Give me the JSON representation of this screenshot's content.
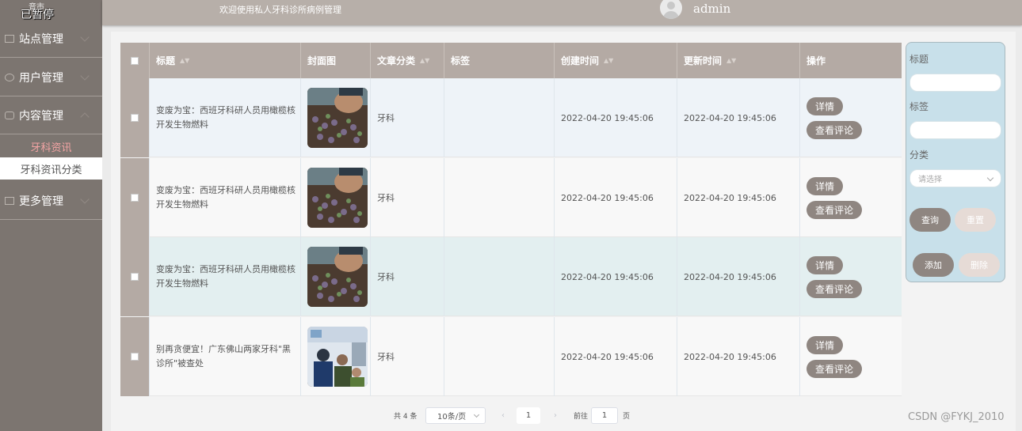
{
  "player": {
    "paused_label": "已暂停",
    "paused_above": "音市"
  },
  "header": {
    "welcome": "欢迎使用私人牙科诊所病例管理",
    "username": "admin"
  },
  "sidebar": {
    "items": [
      {
        "label": "站点管理"
      },
      {
        "label": "用户管理"
      },
      {
        "label": "内容管理"
      },
      {
        "label": "更多管理"
      }
    ],
    "sub_items": [
      {
        "label": "牙科资讯"
      },
      {
        "label": "牙科资讯分类"
      }
    ]
  },
  "table": {
    "columns": [
      "标题",
      "封面图",
      "文章分类",
      "标签",
      "创建时间",
      "更新时间",
      "操作"
    ],
    "rows": [
      {
        "title": "变废为宝：西班牙科研人员用橄榄核开发生物燃料",
        "category": "牙科",
        "tags": "",
        "created": "2022-04-20 19:45:06",
        "updated": "2022-04-20 19:45:06"
      },
      {
        "title": "变废为宝：西班牙科研人员用橄榄核开发生物燃料",
        "category": "牙科",
        "tags": "",
        "created": "2022-04-20 19:45:06",
        "updated": "2022-04-20 19:45:06"
      },
      {
        "title": "变废为宝：西班牙科研人员用橄榄核开发生物燃料",
        "category": "牙科",
        "tags": "",
        "created": "2022-04-20 19:45:06",
        "updated": "2022-04-20 19:45:06"
      },
      {
        "title": "别再贪便宜！广东佛山两家牙科\"黑诊所\"被查处",
        "category": "牙科",
        "tags": "",
        "created": "2022-04-20 19:45:06",
        "updated": "2022-04-20 19:45:06"
      }
    ],
    "actions": {
      "detail": "详情",
      "comments": "查看评论"
    }
  },
  "search": {
    "title_label": "标题",
    "tag_label": "标签",
    "category_label": "分类",
    "category_placeholder": "请选择",
    "query_button": "查询",
    "reset_button": "重置",
    "add_button": "添加",
    "delete_button": "删除"
  },
  "pagination": {
    "total": "共 4 条",
    "page_size": "10条/页",
    "current_page": "1",
    "goto_prefix": "前往",
    "goto_value": "1",
    "goto_suffix": "页"
  },
  "watermark": "CSDN @FYKJ_2010",
  "colors": {
    "sidebar": "#7c7570",
    "header": "#b7afa9",
    "accent": "#8f8681",
    "search_panel": "#c8e0ea",
    "active_sub": "#f3a4a4"
  }
}
